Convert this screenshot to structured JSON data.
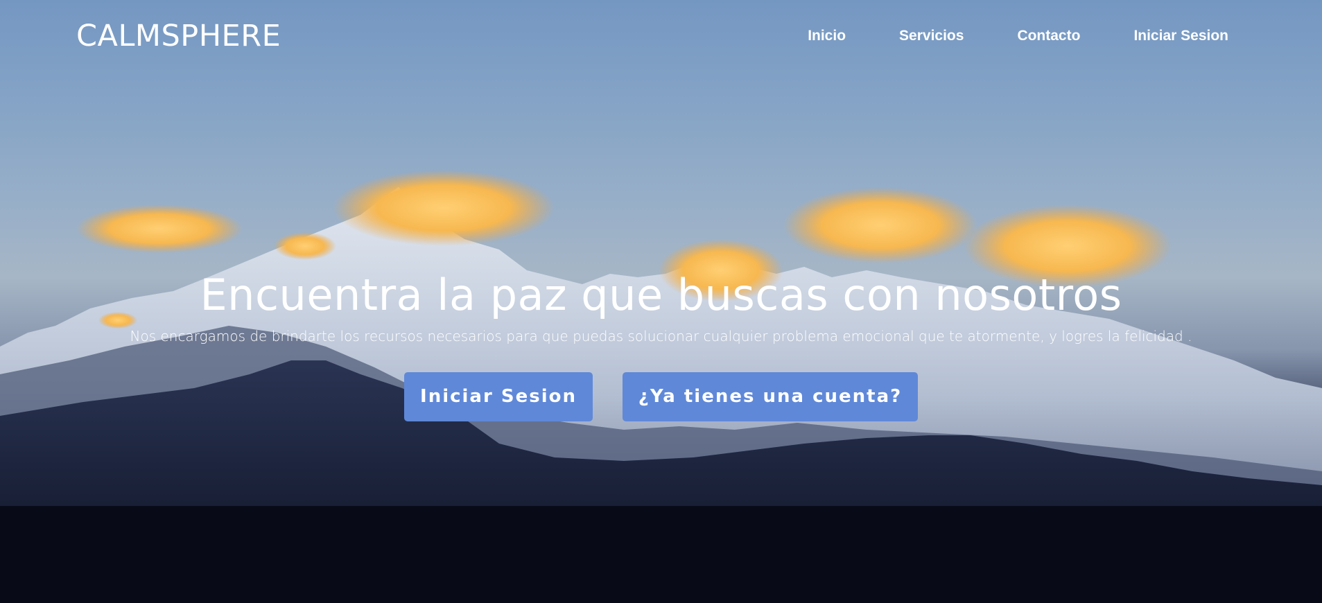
{
  "brand": {
    "name": "CALMSPHERE"
  },
  "nav": {
    "items": [
      {
        "label": "Inicio"
      },
      {
        "label": "Servicios"
      },
      {
        "label": "Contacto"
      },
      {
        "label": "Iniciar Sesion"
      }
    ]
  },
  "hero": {
    "title": "Encuentra la paz que buscas con nosotros",
    "subtitle": "Nos encargamos de brindarte los recursos necesarios para que puedas solucionar cualquier problema emocional que te atormente, y logres la felicidad .",
    "primary_button": "Iniciar Sesion",
    "secondary_button": "¿Ya tienes una cuenta?"
  },
  "colors": {
    "button": "#5f88d8",
    "text": "#ffffff",
    "sky": "#7497c2",
    "ground": "#080b17"
  }
}
